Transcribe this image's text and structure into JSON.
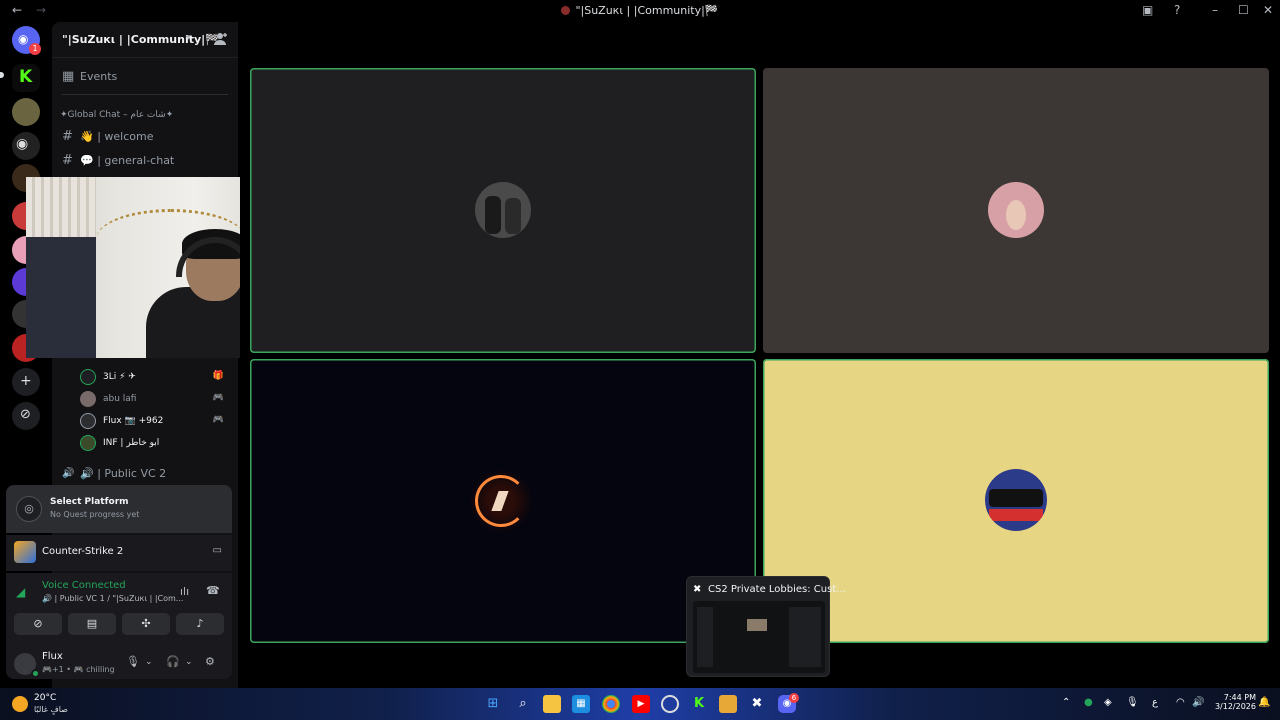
{
  "window": {
    "title": "\"|SuZuкι | |Community|🏁",
    "back": "←",
    "forward": "→"
  },
  "server": {
    "name": "\"|SuZuкι | |Community|🏁",
    "events_label": "Events",
    "category": "✦Global Chat – شات عام✦",
    "channels": [
      {
        "icon": "#",
        "label": "👋 | welcome"
      },
      {
        "icon": "#",
        "label": "💬 | general-chat"
      }
    ],
    "members": [
      {
        "name": "3Li ⚡ ✈",
        "status_icon": "🎁",
        "color": "#f2f3f5"
      },
      {
        "name": "abu lafi",
        "status_icon": "🎮",
        "color": "#949ba4"
      },
      {
        "name": "Flux 📷 +962",
        "status_icon": "🎮",
        "color": "#f2f3f5"
      },
      {
        "name": "INF | ابو خاطر",
        "status_icon": "",
        "color": "#f2f3f5"
      }
    ],
    "voice_channel_2": "🔊 | Public VC 2"
  },
  "quest": {
    "title": "Select Platform",
    "subtitle": "No Quest progress yet"
  },
  "game": {
    "name": "Counter-Strike 2"
  },
  "voice": {
    "status": "Voice Connected",
    "channel": "🔊 | Public VC 1 / \"|SuZuкι | |Com..."
  },
  "user": {
    "name": "Flux",
    "status": "🎮+1 • 🎮 chilling"
  },
  "pip": {
    "title": "CS2 Private Lobbies: Cust..."
  },
  "taskbar": {
    "temperature": "20°C",
    "weather_desc": "صافٍ غالبًا",
    "time": "7:44 PM",
    "date": "3/12/2026",
    "lang": "ع",
    "discord_badge": "6"
  },
  "colors": {
    "speaking": "#3ba55d",
    "tile_dark": "#1f1f21",
    "tile_brown": "#3c3735",
    "tile_navy": "#05050f",
    "tile_yellow": "#e6d583"
  }
}
